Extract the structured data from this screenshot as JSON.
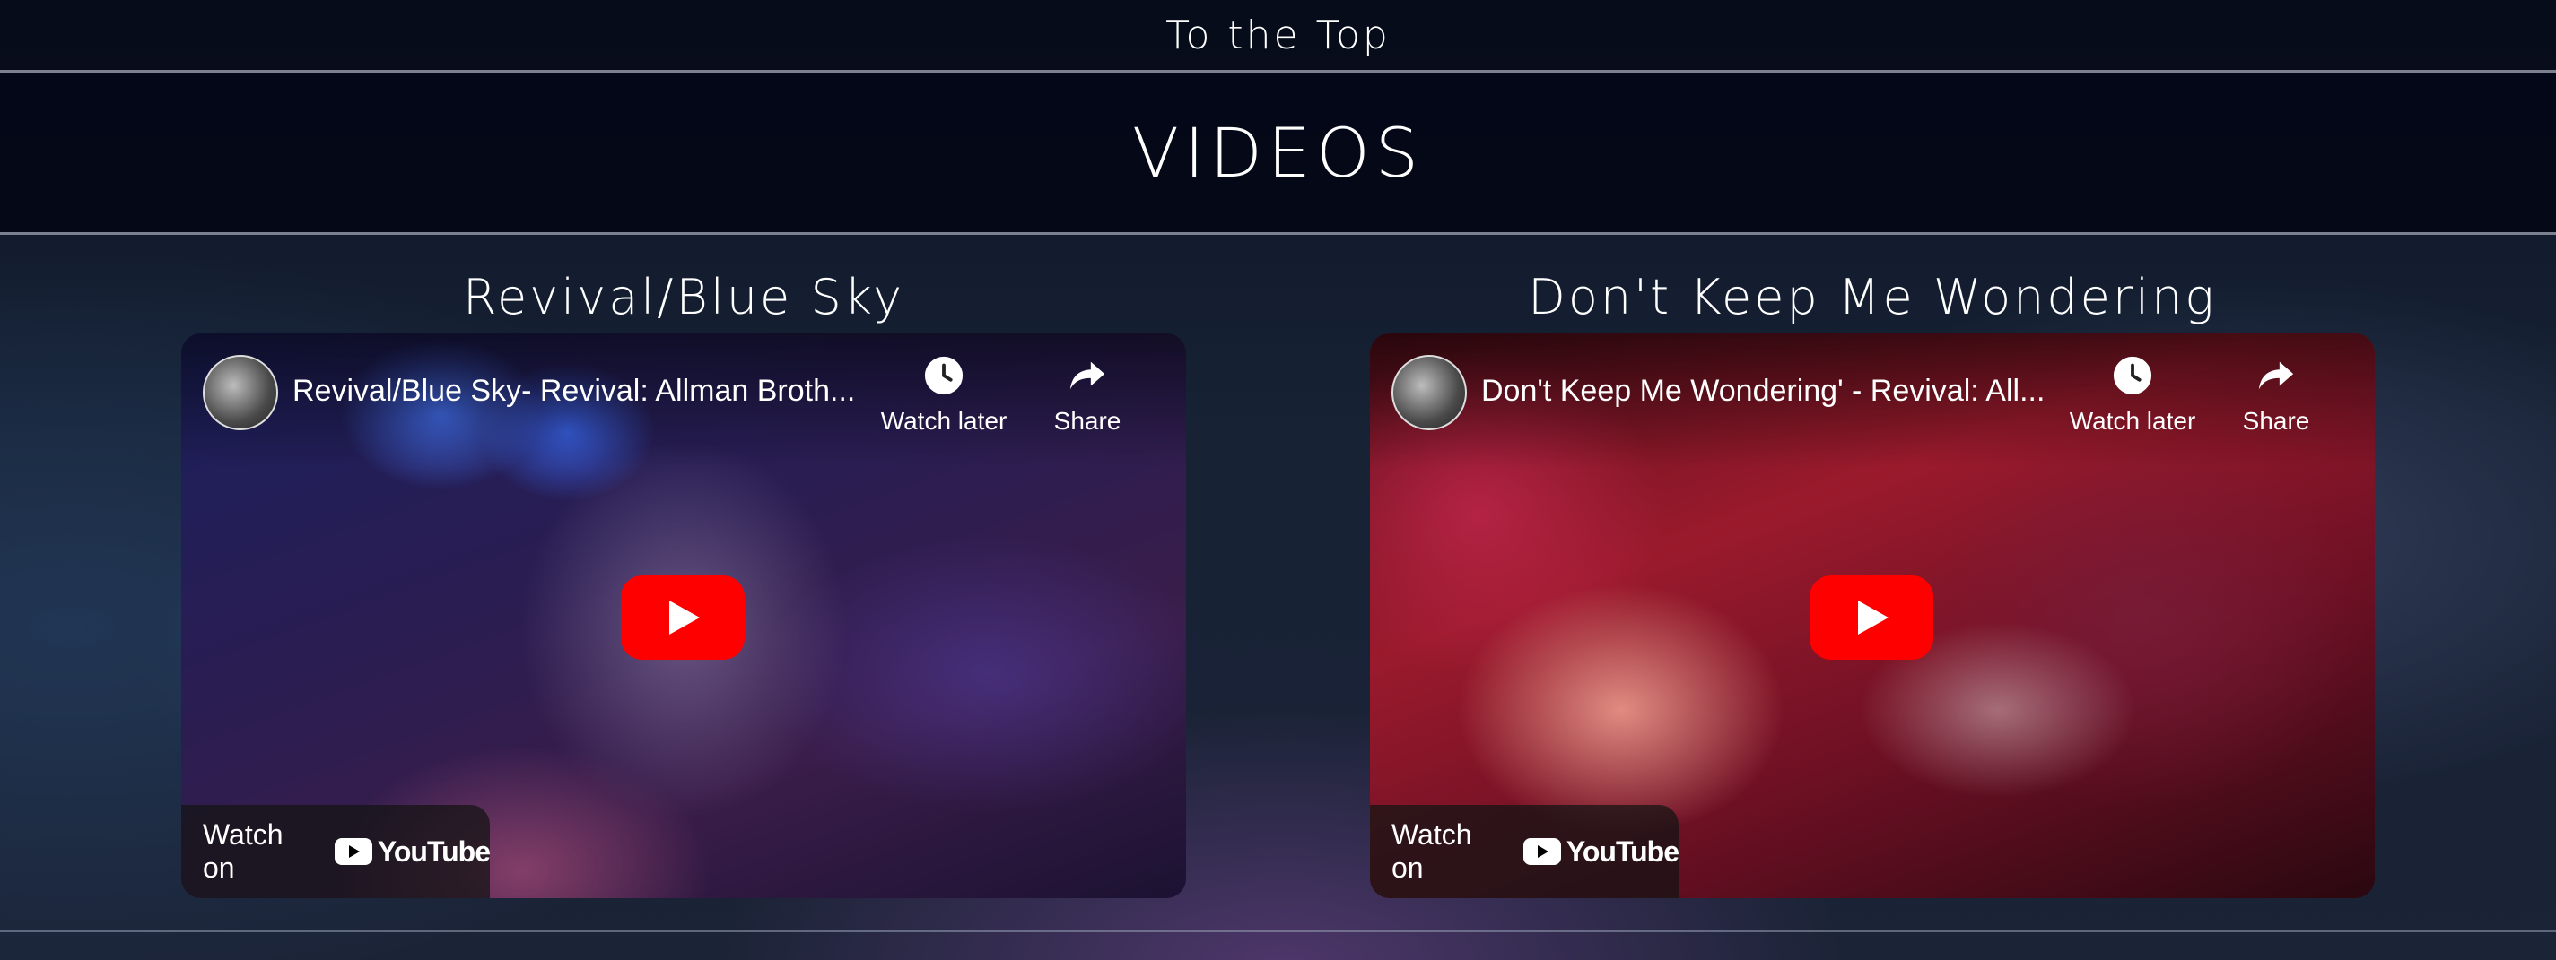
{
  "nav": {
    "to_top": "To the Top"
  },
  "section": {
    "heading": "VIDEOS"
  },
  "videos": [
    {
      "title": "Revival/Blue Sky",
      "caption": "Revival/Blue Sky- Revival: Allman Broth...",
      "watch_later": "Watch later",
      "share": "Share",
      "watch_on": "Watch on",
      "brand": "YouTube"
    },
    {
      "title": "Don't Keep Me Wondering",
      "caption": "Don't Keep Me Wondering' - Revival: All...",
      "watch_later": "Watch later",
      "share": "Share",
      "watch_on": "Watch on",
      "brand": "YouTube"
    }
  ],
  "icons": {
    "clock": "clock-icon",
    "share": "share-arrow-icon",
    "play": "play-icon",
    "youtube": "youtube-logo-icon"
  },
  "colors": {
    "play_button": "#ff0000",
    "divider": "#7c8190",
    "band": "#030616"
  }
}
